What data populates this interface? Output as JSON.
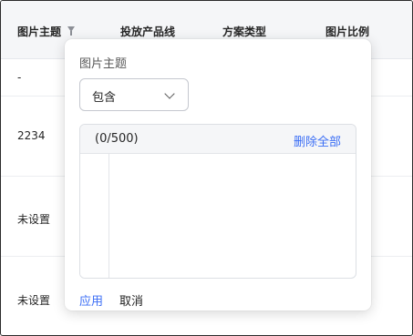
{
  "table": {
    "columns": [
      "图片主题",
      "投放产品线",
      "方案类型",
      "图片比例"
    ],
    "rows": [
      "-",
      "2234",
      "未设置",
      "未设置"
    ]
  },
  "filter_popover": {
    "title": "图片主题",
    "operator": "包含",
    "counter": "(0/500)",
    "clear_all": "删除全部",
    "textarea_value": "",
    "apply": "应用",
    "cancel": "取消"
  },
  "icons": {
    "filter": "filter-icon",
    "dropdown": "chevron-down-icon"
  }
}
